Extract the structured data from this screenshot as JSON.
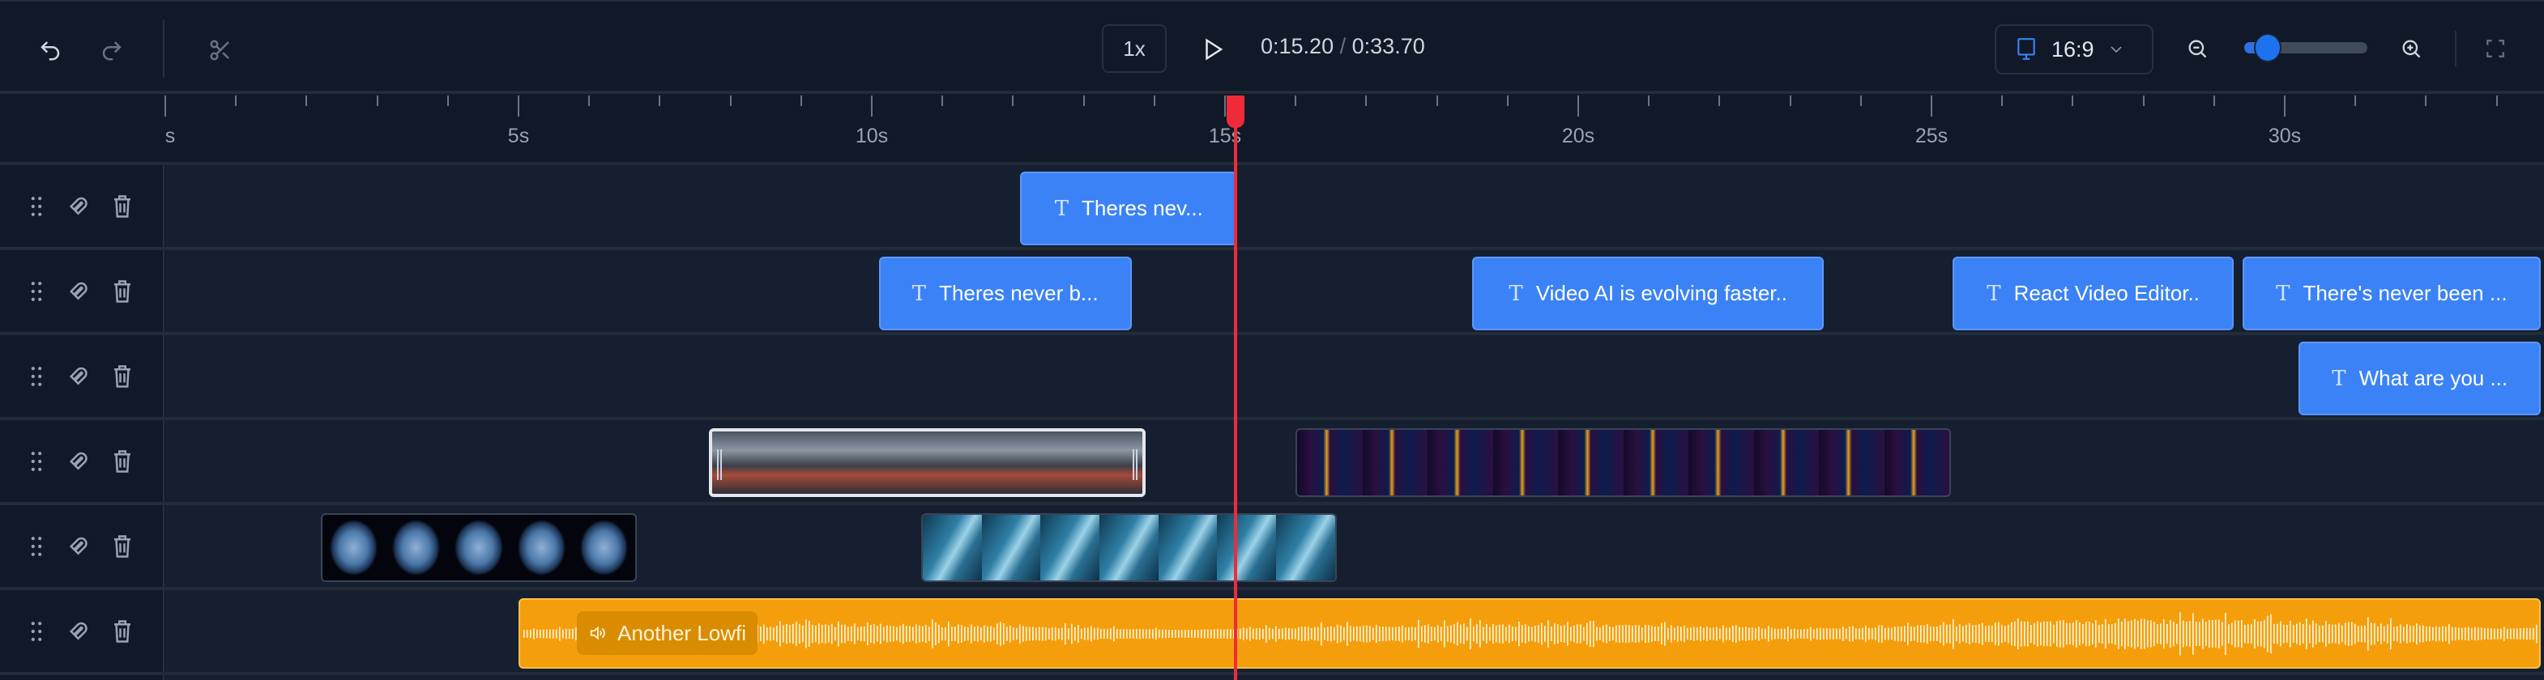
{
  "toolbar": {
    "undo_icon": "undo-icon",
    "redo_icon": "redo-icon",
    "split_icon": "scissors-icon",
    "speed": "1x",
    "current_time": "0:15.20",
    "separator": "/",
    "duration": "0:33.70",
    "aspect_ratio": "16:9",
    "zoom_level": 0.15,
    "accent": "#3b82f6"
  },
  "ruler": {
    "labels": [
      "s",
      "5s",
      "10s",
      "15s",
      "20s",
      "25s",
      "30s"
    ]
  },
  "playhead_time": 15.2,
  "tracks": [
    {
      "clips": [
        {
          "type": "text",
          "label": "Theres nev...",
          "start": 12.1,
          "end": 15.2
        }
      ]
    },
    {
      "clips": [
        {
          "type": "text",
          "label": "Theres never b...",
          "start": 10.1,
          "end": 13.7
        },
        {
          "type": "text",
          "label": "Video AI is evolving faster..",
          "start": 18.5,
          "end": 23.5
        },
        {
          "type": "text",
          "label": "React Video Editor..",
          "start": 25.3,
          "end": 29.3
        },
        {
          "type": "text",
          "label": "There's never been ...",
          "start": 29.4,
          "end": 33.7
        }
      ]
    },
    {
      "clips": [
        {
          "type": "text",
          "label": "What are you ...",
          "start": 30.2,
          "end": 33.7
        }
      ]
    },
    {
      "clips": [
        {
          "type": "video",
          "theme": "industrial",
          "start": 7.7,
          "end": 13.9,
          "selected": true
        },
        {
          "type": "video",
          "theme": "neon",
          "start": 16.0,
          "end": 25.3
        }
      ]
    },
    {
      "clips": [
        {
          "type": "video",
          "theme": "earth",
          "start": 2.2,
          "end": 6.7
        },
        {
          "type": "video",
          "theme": "underwater",
          "start": 10.7,
          "end": 16.6
        }
      ]
    },
    {
      "clips": [
        {
          "type": "audio",
          "label": "Another Lowfi",
          "start": 5.0,
          "end": 33.7
        }
      ]
    }
  ],
  "colors": {
    "text_clip": "#3b82f6",
    "audio_clip": "#f59e0b",
    "playhead": "#ef2b3a"
  }
}
